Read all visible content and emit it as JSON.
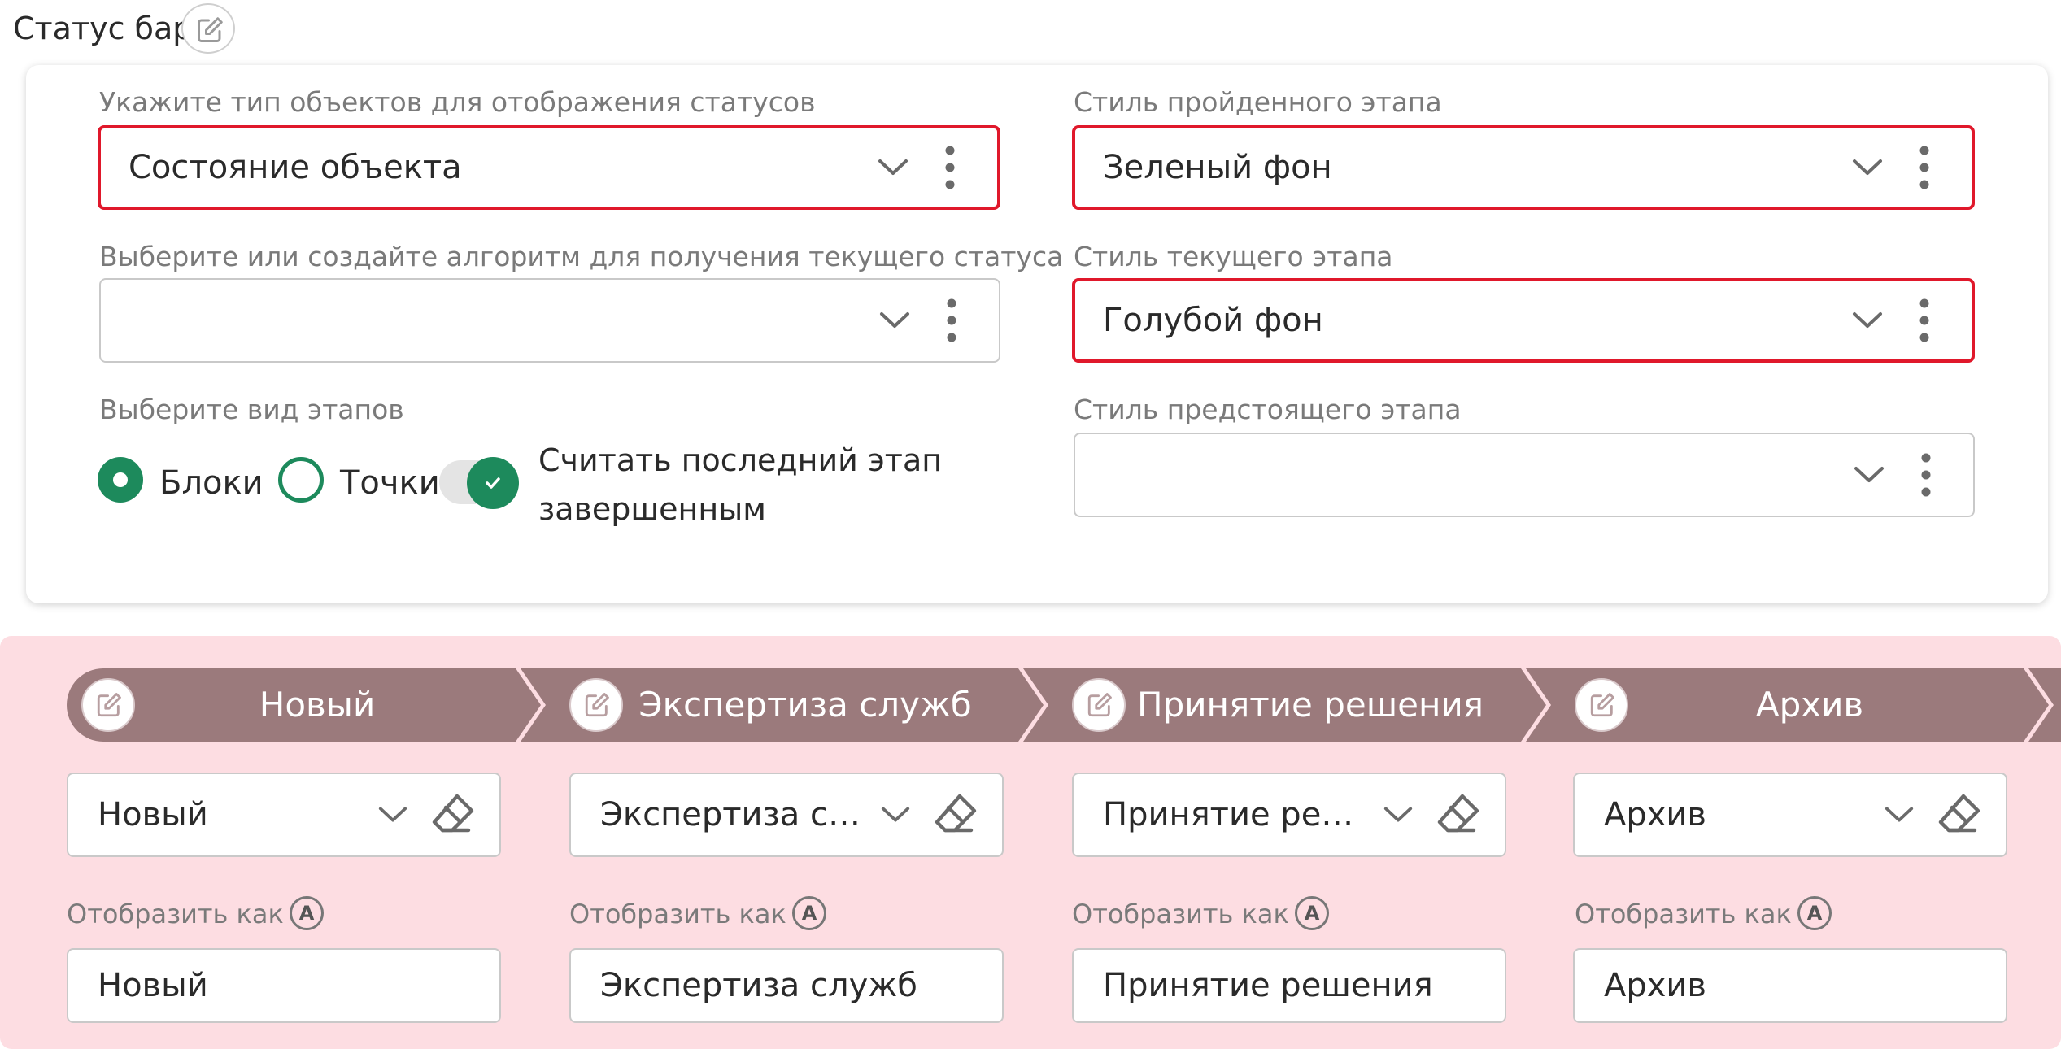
{
  "header": {
    "title": "Статус бар",
    "edit_icon": "pencil-square-icon"
  },
  "form": {
    "object_type": {
      "label": "Укажите тип объектов для отображения статусов",
      "value": "Состояние объекта"
    },
    "algorithm": {
      "label": "Выберите или создайте алгоритм для получения текущего статуса",
      "value": ""
    },
    "stage_view": {
      "label": "Выберите вид этапов",
      "options": [
        {
          "label": "Блоки",
          "selected": true
        },
        {
          "label": "Точки",
          "selected": false
        }
      ]
    },
    "last_stage_toggle": {
      "line1": "Считать последний этап",
      "line2": "завершенным",
      "checked": true
    },
    "passed_style": {
      "label": "Стиль пройденного этапа",
      "value": "Зеленый фон"
    },
    "current_style": {
      "label": "Стиль текущего этапа",
      "value": "Голубой фон"
    },
    "upcoming_style": {
      "label": "Стиль предстоящего этапа",
      "value": ""
    }
  },
  "preview": {
    "display_as_label": "Отобразить как",
    "stages": [
      {
        "name": "Новый",
        "select_value": "Новый",
        "display_value": "Новый"
      },
      {
        "name": "Экспертиза служб",
        "select_value": "Экспертиза с…",
        "display_value": "Экспертиза служб"
      },
      {
        "name": "Принятие решения",
        "select_value": "Принятие ре…",
        "display_value": "Принятие решения"
      },
      {
        "name": "Архив",
        "select_value": "Архив",
        "display_value": "Архив"
      }
    ]
  },
  "colors": {
    "accent_green": "#1d8a5c",
    "highlight_red": "#e0182b",
    "stage_bg": "#9b7a7c",
    "preview_bg": "#fddde2"
  }
}
